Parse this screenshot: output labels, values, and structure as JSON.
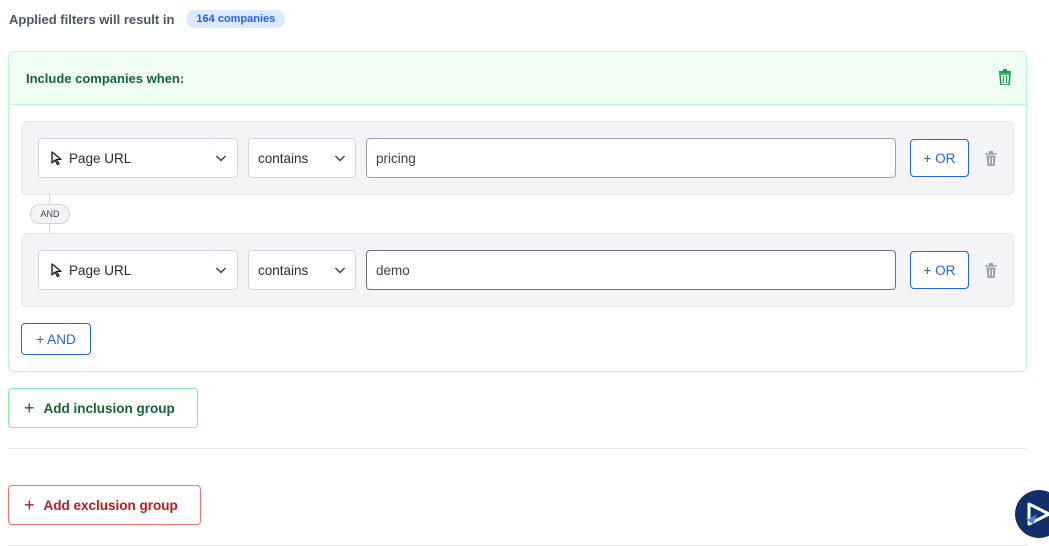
{
  "summary": {
    "label": "Applied filters will result in",
    "count_badge": "164 companies"
  },
  "include_group": {
    "title": "Include companies when:",
    "rules": [
      {
        "field": "Page URL",
        "operator": "contains",
        "value": "pricing",
        "or_label": "+ OR"
      },
      {
        "field": "Page URL",
        "operator": "contains",
        "value": "demo",
        "or_label": "+ OR"
      }
    ],
    "connector_label": "AND",
    "add_and_label": "+ AND"
  },
  "actions": {
    "add_inclusion_label": "Add inclusion group",
    "add_exclusion_label": "Add exclusion group"
  },
  "colors": {
    "accent_blue": "#2563eb",
    "include_green": "#166534",
    "exclude_red": "#b91c1c",
    "launcher_navy": "#14306a"
  }
}
